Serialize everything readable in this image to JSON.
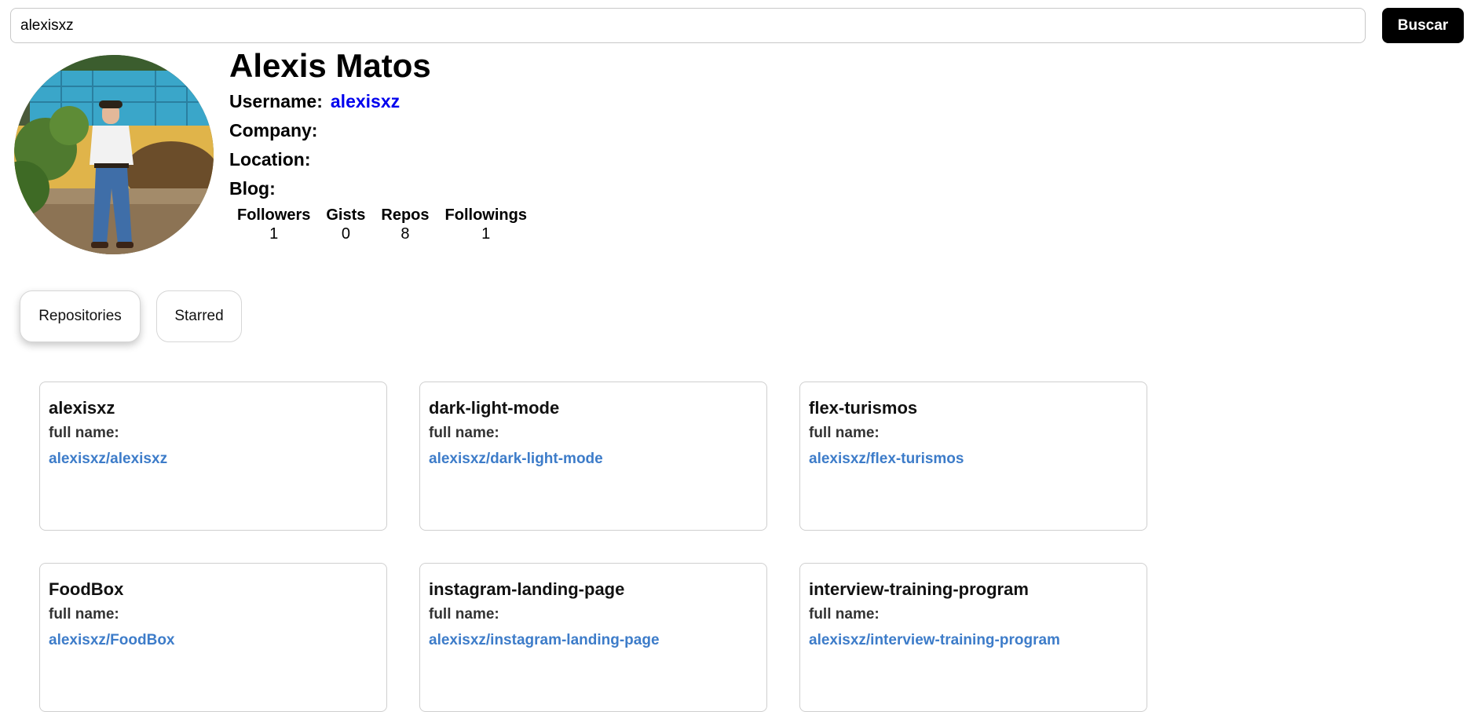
{
  "search": {
    "value": "alexisxz",
    "button_label": "Buscar"
  },
  "profile": {
    "name": "Alexis Matos",
    "fields": [
      {
        "label": "Username:",
        "value": "alexisxz"
      },
      {
        "label": "Company:",
        "value": ""
      },
      {
        "label": "Location:",
        "value": ""
      },
      {
        "label": "Blog:",
        "value": ""
      }
    ],
    "stats": [
      {
        "label": "Followers",
        "value": "1"
      },
      {
        "label": "Gists",
        "value": "0"
      },
      {
        "label": "Repos",
        "value": "8"
      },
      {
        "label": "Followings",
        "value": "1"
      }
    ]
  },
  "tabs": [
    {
      "label": "Repositories",
      "active": true
    },
    {
      "label": "Starred",
      "active": false
    }
  ],
  "repos": [
    {
      "name": "alexisxz",
      "full_name_label": "full name:",
      "full_name": "alexisxz/alexisxz"
    },
    {
      "name": "dark-light-mode",
      "full_name_label": "full name:",
      "full_name": "alexisxz/dark-light-mode"
    },
    {
      "name": "flex-turismos",
      "full_name_label": "full name:",
      "full_name": "alexisxz/flex-turismos"
    },
    {
      "name": "FoodBox",
      "full_name_label": "full name:",
      "full_name": "alexisxz/FoodBox"
    },
    {
      "name": "instagram-landing-page",
      "full_name_label": "full name:",
      "full_name": "alexisxz/instagram-landing-page"
    },
    {
      "name": "interview-training-program",
      "full_name_label": "full name:",
      "full_name": "alexisxz/interview-training-program"
    }
  ],
  "colors": {
    "link": "#0000ee",
    "repo_link": "#3d7cc9",
    "button_bg": "#000000"
  }
}
